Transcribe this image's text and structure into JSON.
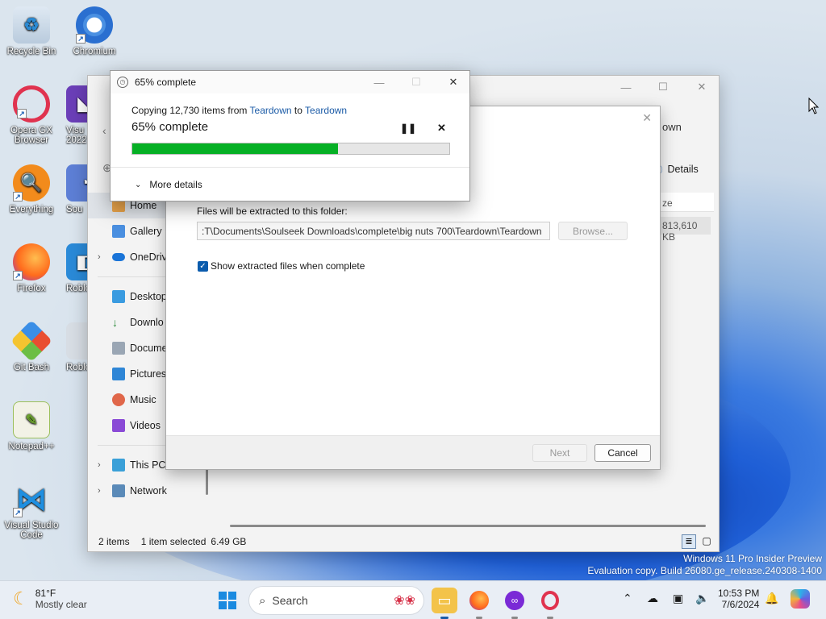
{
  "desktop": {
    "icons": [
      {
        "label": "Recycle Bin"
      },
      {
        "label": "Chromium"
      },
      {
        "label": "Opera GX Browser"
      },
      {
        "label": "Visu 2022"
      },
      {
        "label": "Everything"
      },
      {
        "label": "Sou"
      },
      {
        "label": "Firefox"
      },
      {
        "label": "Roblo"
      },
      {
        "label": "Git Bash"
      },
      {
        "label": "Roblo"
      },
      {
        "label": "Notepad++"
      },
      {
        "label": "Visual Studio Code"
      }
    ],
    "watermark_line1": "Windows 11 Pro Insider Preview",
    "watermark_line2": "Evaluation copy. Build 26080.ge_release.240308-1400"
  },
  "explorer": {
    "header_partial": "own",
    "details_label": "Details",
    "column_partial": "ze",
    "size_value": "813,610 KB",
    "nav": {
      "home": "Home",
      "gallery": "Gallery",
      "onedrive": "OneDriv",
      "desktop": "Desktop",
      "downloads": "Downlo",
      "documents": "Docume",
      "pictures": "Pictures",
      "music": "Music",
      "videos": "Videos",
      "thispc": "This PC",
      "network": "Network"
    },
    "status": {
      "items": "2 items",
      "selected": "1 item selected",
      "size": "6.49 GB"
    }
  },
  "wizard": {
    "dest_label": "Files will be extracted to this folder:",
    "dest_path": ":T\\Documents\\Soulseek Downloads\\complete\\big nuts 700\\Teardown\\Teardown",
    "browse": "Browse...",
    "show_files_label": "Show extracted files when complete",
    "show_files_checked": true,
    "next": "Next",
    "cancel": "Cancel"
  },
  "copy_dialog": {
    "title": "65% complete",
    "copying_prefix": "Copying 12,730 items from",
    "source": "Teardown",
    "to": "to",
    "destination": "Teardown",
    "percent_text": "65% complete",
    "progress_fraction": 0.65,
    "more_details": "More details"
  },
  "taskbar": {
    "weather_temp": "81°F",
    "weather_desc": "Mostly clear",
    "search_placeholder": "Search",
    "time": "10:53 PM",
    "date": "7/6/2024"
  },
  "colors": {
    "progress": "#06b025",
    "link": "#1a5aa6",
    "accent": "#0b5cad"
  }
}
